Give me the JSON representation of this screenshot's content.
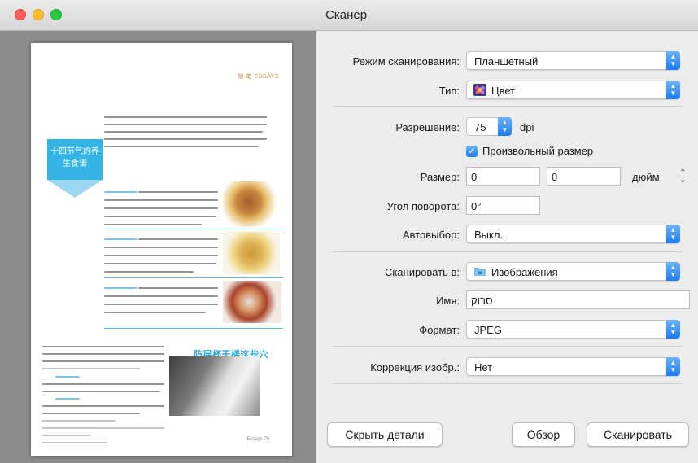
{
  "window": {
    "title": "Сканер"
  },
  "preview": {
    "essays_tag": "随 笔 ESSAYS",
    "box_title": "十四节气的养生食谱",
    "headline": "防层杯干楼这些穴",
    "page_number": "Essays 79"
  },
  "settings": {
    "scan_mode": {
      "label": "Режим сканирования:",
      "value": "Планшетный"
    },
    "kind": {
      "label": "Тип:",
      "value": "Цвет",
      "icon": "color-flower-icon"
    },
    "resolution": {
      "label": "Разрешение:",
      "value": "75",
      "unit": "dpi"
    },
    "custom_size": {
      "label": "Произвольный размер",
      "checked": true
    },
    "size": {
      "label": "Размер:",
      "width": "0",
      "height": "0",
      "unit": "дюйм"
    },
    "rotation": {
      "label": "Угол поворота:",
      "value": "0°"
    },
    "autoselect": {
      "label": "Автовыбор:",
      "value": "Выкл."
    },
    "scan_to": {
      "label": "Сканировать в:",
      "value": "Изображения",
      "icon": "folder-icon"
    },
    "name": {
      "label": "Имя:",
      "value": "סרוק"
    },
    "format": {
      "label": "Формат:",
      "value": "JPEG"
    },
    "correction": {
      "label": "Коррекция изобр.:",
      "value": "Нет"
    }
  },
  "buttons": {
    "hide_details": "Скрыть детали",
    "browse": "Обзор",
    "scan": "Сканировать"
  },
  "colors": {
    "accent": "#1b7cf2",
    "preview_bg": "#8c8c8c",
    "article_blue": "#33b4e4"
  }
}
